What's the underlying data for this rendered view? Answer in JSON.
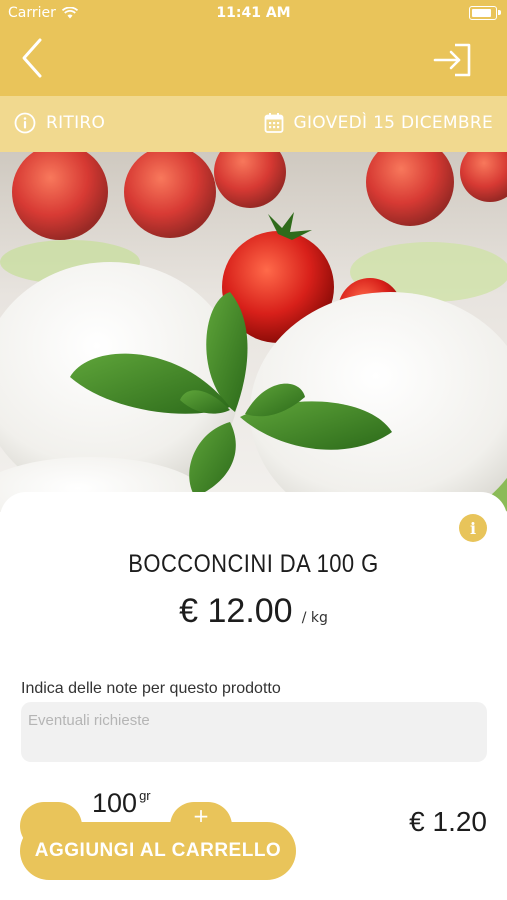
{
  "status_bar": {
    "carrier": "Carrier",
    "time": "11:41 AM"
  },
  "nav": {
    "back_icon": "chevron-left-icon",
    "login_icon": "sign-in-icon"
  },
  "info_bar": {
    "pickup_label": "RITIRO",
    "date_label": "GIOVEDÌ 15 DICEMBRE"
  },
  "product": {
    "image": "mozzarella-bocconcini-photo",
    "title": "BOCCONCINI DA 100 G",
    "price": "€ 12.00",
    "unit": "/ kg"
  },
  "notes": {
    "label": "Indica delle note per questo prodotto",
    "placeholder": "Eventuali richieste"
  },
  "quantity": {
    "value": "100",
    "unit": "gr"
  },
  "actions": {
    "add_to_cart": "AGGIUNGI AL CARRELLO"
  },
  "total": "€ 1.20",
  "colors": {
    "primary": "#e9c45a",
    "secondary": "#f1d98f"
  }
}
